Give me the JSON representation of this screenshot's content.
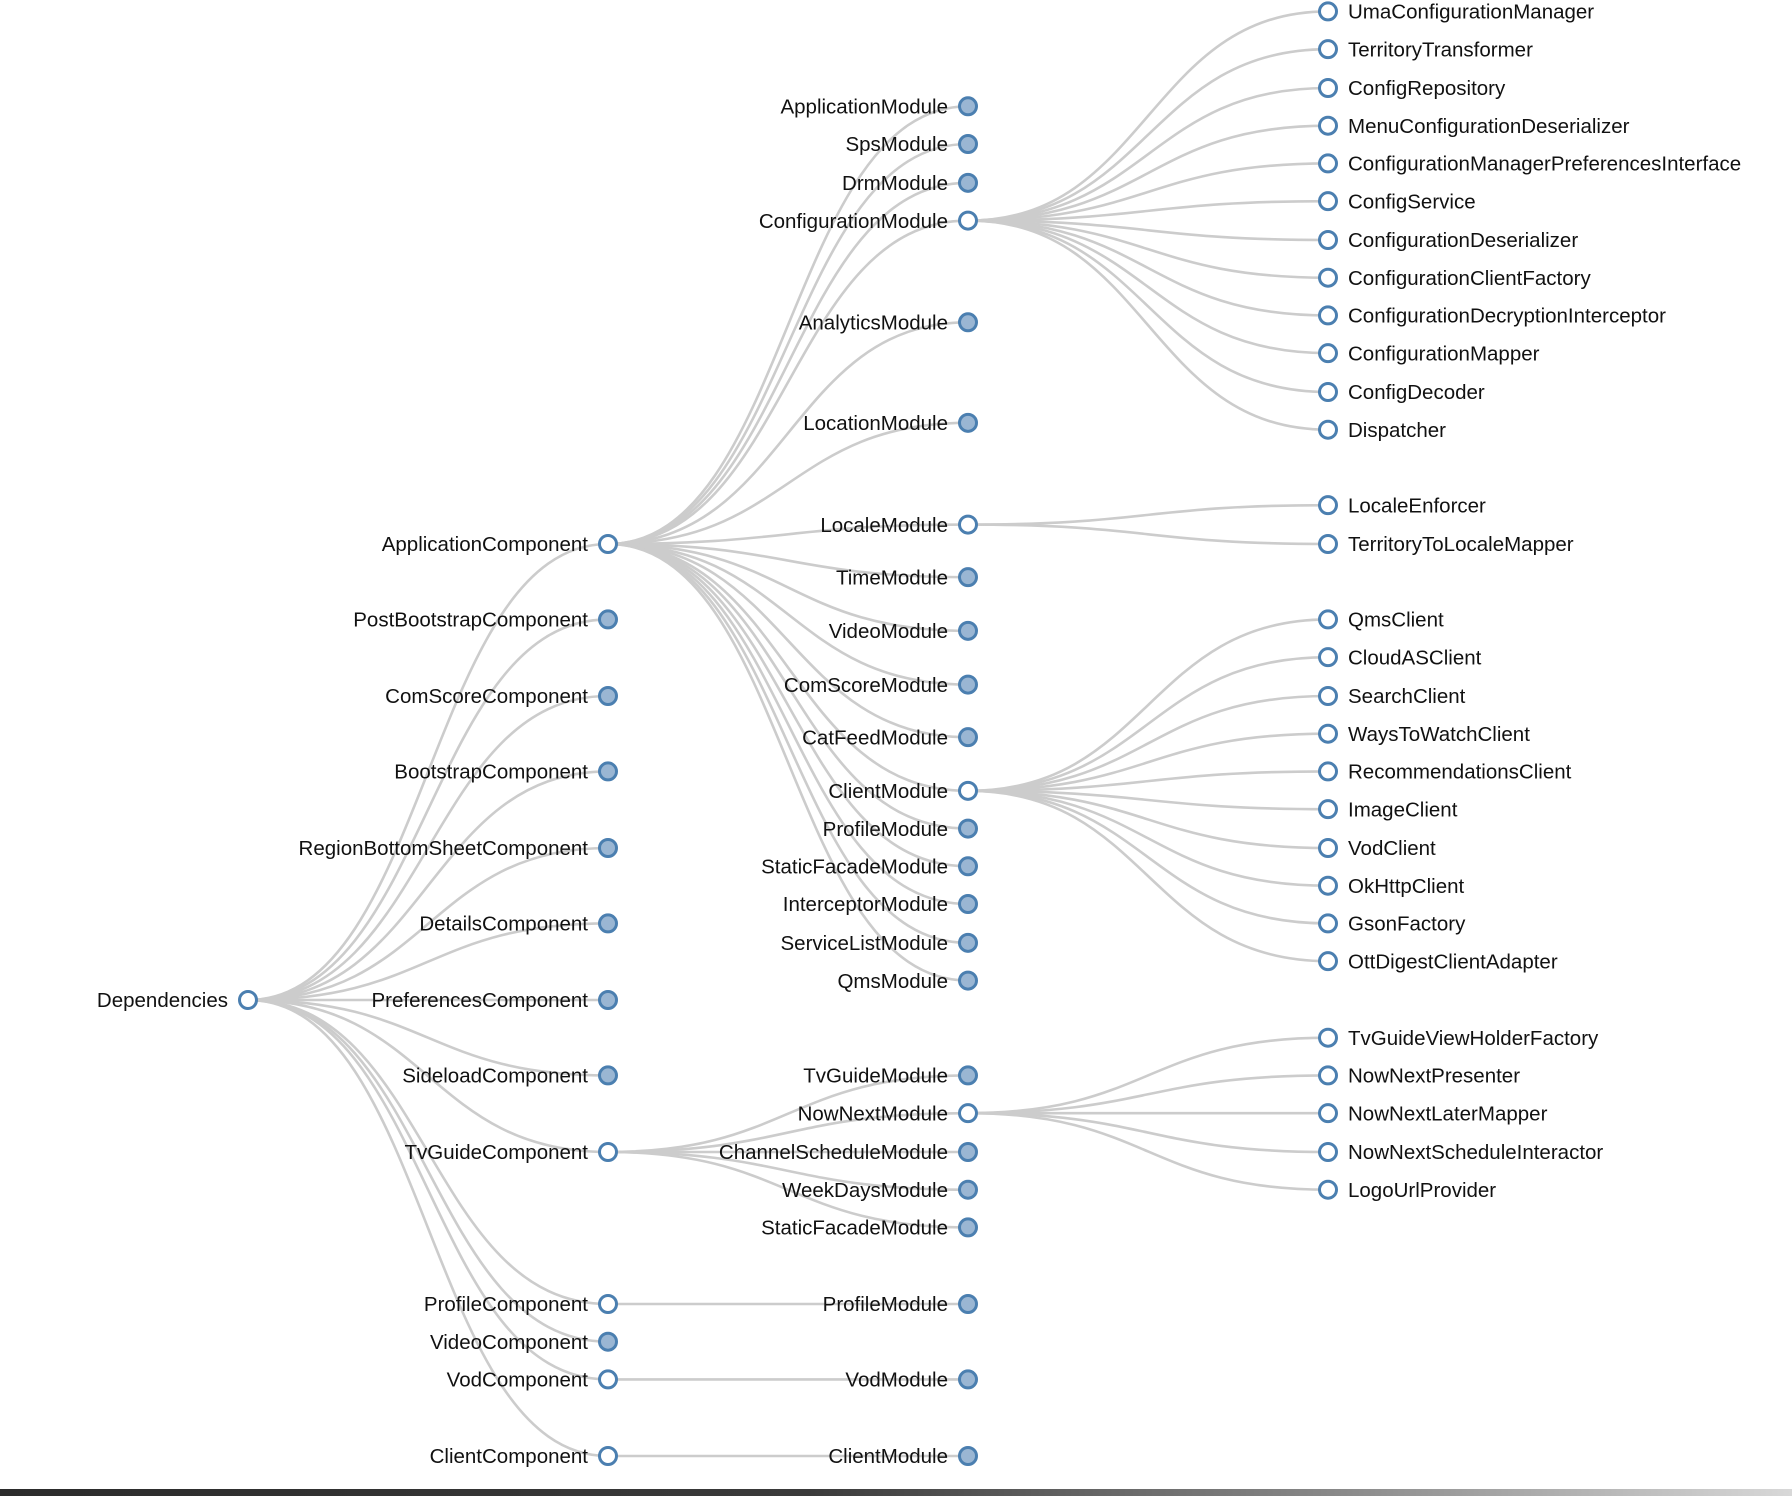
{
  "colors": {
    "link": "#cccccc",
    "node_stroke": "#4b7fb0",
    "collapsed_fill": "#9ab6d3",
    "expanded_fill": "#ffffff",
    "label": "#111111"
  },
  "tree": {
    "label": "Dependencies",
    "collapsed": false,
    "children": [
      {
        "label": "ApplicationComponent",
        "collapsed": false,
        "children": [
          {
            "label": "ApplicationModule",
            "collapsed": true
          },
          {
            "label": "SpsModule",
            "collapsed": true
          },
          {
            "label": "DrmModule",
            "collapsed": true
          },
          {
            "label": "ConfigurationModule",
            "collapsed": false,
            "children": [
              {
                "label": "UmaConfigurationManager",
                "collapsed": false
              },
              {
                "label": "TerritoryTransformer",
                "collapsed": false
              },
              {
                "label": "ConfigRepository",
                "collapsed": false
              },
              {
                "label": "MenuConfigurationDeserializer",
                "collapsed": false
              },
              {
                "label": "ConfigurationManagerPreferencesInterface",
                "collapsed": false
              },
              {
                "label": "ConfigService",
                "collapsed": false
              },
              {
                "label": "ConfigurationDeserializer",
                "collapsed": false
              },
              {
                "label": "ConfigurationClientFactory",
                "collapsed": false
              },
              {
                "label": "ConfigurationDecryptionInterceptor",
                "collapsed": false
              },
              {
                "label": "ConfigurationMapper",
                "collapsed": false
              },
              {
                "label": "ConfigDecoder",
                "collapsed": false
              },
              {
                "label": "Dispatcher",
                "collapsed": false
              }
            ]
          },
          {
            "label": "AnalyticsModule",
            "collapsed": true
          },
          {
            "label": "LocationModule",
            "collapsed": true
          },
          {
            "label": "LocaleModule",
            "collapsed": false,
            "children": [
              {
                "label": "LocaleEnforcer",
                "collapsed": false
              },
              {
                "label": "TerritoryToLocaleMapper",
                "collapsed": false
              }
            ]
          },
          {
            "label": "TimeModule",
            "collapsed": true
          },
          {
            "label": "VideoModule",
            "collapsed": true
          },
          {
            "label": "ComScoreModule",
            "collapsed": true
          },
          {
            "label": "CatFeedModule",
            "collapsed": true
          },
          {
            "label": "ClientModule",
            "collapsed": false,
            "children": [
              {
                "label": "QmsClient",
                "collapsed": false
              },
              {
                "label": "CloudASClient",
                "collapsed": false
              },
              {
                "label": "SearchClient",
                "collapsed": false
              },
              {
                "label": "WaysToWatchClient",
                "collapsed": false
              },
              {
                "label": "RecommendationsClient",
                "collapsed": false
              },
              {
                "label": "ImageClient",
                "collapsed": false
              },
              {
                "label": "VodClient",
                "collapsed": false
              },
              {
                "label": "OkHttpClient",
                "collapsed": false
              },
              {
                "label": "GsonFactory",
                "collapsed": false
              },
              {
                "label": "OttDigestClientAdapter",
                "collapsed": false
              }
            ]
          },
          {
            "label": "ProfileModule",
            "collapsed": true
          },
          {
            "label": "StaticFacadeModule",
            "collapsed": true
          },
          {
            "label": "InterceptorModule",
            "collapsed": true
          },
          {
            "label": "ServiceListModule",
            "collapsed": true
          },
          {
            "label": "QmsModule",
            "collapsed": true
          }
        ]
      },
      {
        "label": "PostBootstrapComponent",
        "collapsed": true
      },
      {
        "label": "ComScoreComponent",
        "collapsed": true
      },
      {
        "label": "BootstrapComponent",
        "collapsed": true
      },
      {
        "label": "RegionBottomSheetComponent",
        "collapsed": true
      },
      {
        "label": "DetailsComponent",
        "collapsed": true
      },
      {
        "label": "PreferencesComponent",
        "collapsed": true
      },
      {
        "label": "SideloadComponent",
        "collapsed": true
      },
      {
        "label": "TvGuideComponent",
        "collapsed": false,
        "children": [
          {
            "label": "TvGuideModule",
            "collapsed": true
          },
          {
            "label": "NowNextModule",
            "collapsed": false,
            "children": [
              {
                "label": "TvGuideViewHolderFactory",
                "collapsed": false
              },
              {
                "label": "NowNextPresenter",
                "collapsed": false
              },
              {
                "label": "NowNextLaterMapper",
                "collapsed": false
              },
              {
                "label": "NowNextScheduleInteractor",
                "collapsed": false
              },
              {
                "label": "LogoUrlProvider",
                "collapsed": false
              }
            ]
          },
          {
            "label": "ChannelScheduleModule",
            "collapsed": true
          },
          {
            "label": "WeekDaysModule",
            "collapsed": true
          },
          {
            "label": "StaticFacadeModule",
            "collapsed": true
          }
        ]
      },
      {
        "label": "ProfileComponent",
        "collapsed": false,
        "children": [
          {
            "label": "ProfileModule",
            "collapsed": true
          }
        ]
      },
      {
        "label": "VideoComponent",
        "collapsed": true
      },
      {
        "label": "VodComponent",
        "collapsed": false,
        "children": [
          {
            "label": "VodModule",
            "collapsed": true
          }
        ]
      },
      {
        "label": "ClientComponent",
        "collapsed": false,
        "children": [
          {
            "label": "ClientModule",
            "collapsed": true
          }
        ]
      }
    ]
  }
}
